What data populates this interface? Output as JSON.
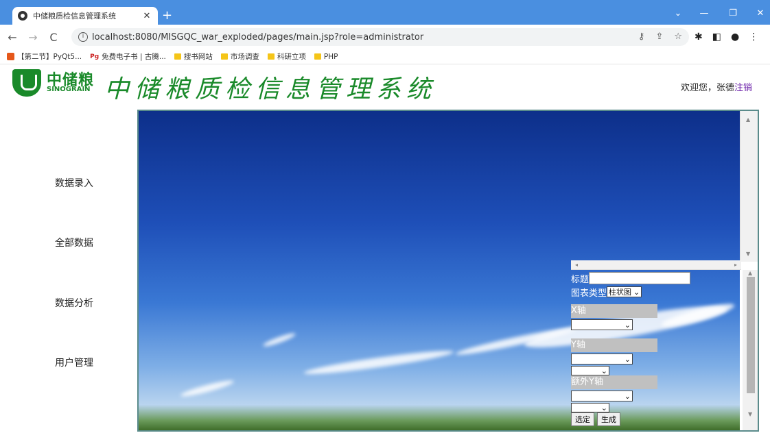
{
  "browser": {
    "tab_title": "中储粮质检信息管理系统",
    "url": "localhost:8080/MISGQC_war_exploded/pages/main.jsp?role=administrator",
    "bookmarks": [
      {
        "label": "【第二节】PyQt5..."
      },
      {
        "label": "免费电子书 | 古腾..."
      },
      {
        "label": "搜书网站"
      },
      {
        "label": "市场调查"
      },
      {
        "label": "科研立项"
      },
      {
        "label": "PHP"
      }
    ]
  },
  "header": {
    "logo_cn": "中储粮",
    "logo_en": "SINOGRAIN",
    "system_title": "中储粮质检信息管理系统",
    "welcome_text": "欢迎您，张德",
    "logout": "注销"
  },
  "sidebar": {
    "items": [
      {
        "label": "数据录入"
      },
      {
        "label": "全部数据"
      },
      {
        "label": "数据分析"
      },
      {
        "label": "用户管理"
      }
    ]
  },
  "chart_config": {
    "title_label": "标题",
    "title_value": "",
    "chart_type_label": "图表类型",
    "chart_type_value": "柱状图",
    "x_axis_label": "X轴",
    "y_axis_label": "Y轴",
    "extra_y_label": "额外Y轴",
    "select_button": "选定",
    "generate_button": "生成"
  }
}
